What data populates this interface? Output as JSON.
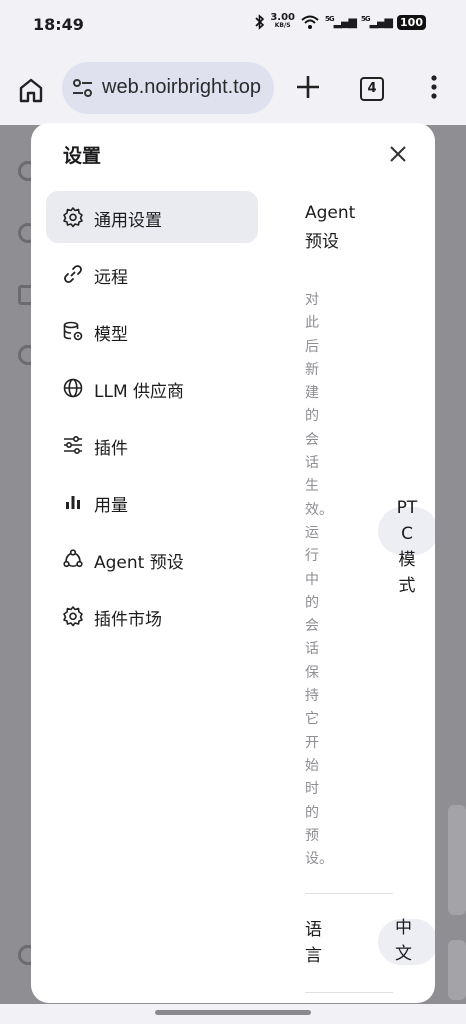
{
  "status_bar": {
    "time": "18:49",
    "net_speed": "3.00",
    "net_unit": "KB/S",
    "signal1": "5G",
    "signal2": "5G",
    "battery": "100"
  },
  "browser": {
    "url": "web.noirbright.top",
    "tab_count": "4",
    "icons": [
      "home-icon",
      "site-settings-icon",
      "plus-icon",
      "tabs-icon",
      "more-vert-icon"
    ]
  },
  "settings": {
    "title": "设置",
    "nav": [
      {
        "label": "通用设置",
        "icon": "gear-icon",
        "active": true
      },
      {
        "label": "远程",
        "icon": "link-icon",
        "active": false
      },
      {
        "label": "模型",
        "icon": "database-gear-icon",
        "active": false
      },
      {
        "label": "LLM 供应商",
        "icon": "globe-icon",
        "active": false
      },
      {
        "label": "插件",
        "icon": "sliders-icon",
        "active": false
      },
      {
        "label": "用量",
        "icon": "bar-chart-icon",
        "active": false
      },
      {
        "label": "Agent 预设",
        "icon": "nodes-icon",
        "active": false
      },
      {
        "label": "插件市场",
        "icon": "gear-icon",
        "active": false
      }
    ],
    "agent_preset": {
      "title": "Agent 预设",
      "description": "对此后新建的会话生效。运行中的会话保持它开始时的预设。",
      "value": "PTC 模式"
    },
    "language": {
      "label": "语言",
      "value": "中文"
    }
  },
  "colors": {
    "accent_active_bg": "#e9ebf0",
    "muted_text": "#8e8e93",
    "backdrop": "#8f8f93"
  }
}
